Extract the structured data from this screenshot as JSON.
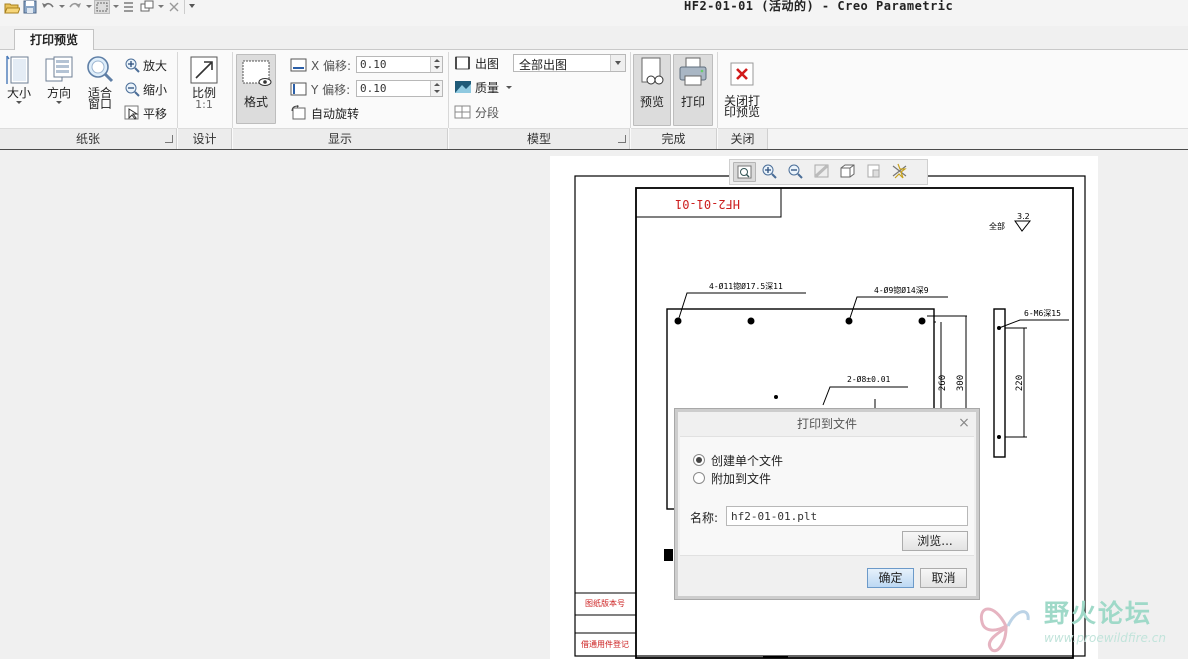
{
  "window": {
    "title": "HF2-01-01 (活动的) - Creo Parametric"
  },
  "tabs": [
    {
      "label": "打印预览",
      "active": true
    }
  ],
  "ribbon": {
    "groups": [
      {
        "label": "纸张"
      },
      {
        "label": "设计"
      },
      {
        "label": "显示"
      },
      {
        "label": "模型"
      },
      {
        "label": "完成"
      },
      {
        "label": "关闭"
      }
    ],
    "paper": {
      "size_label": "大小",
      "orientation_label": "方向",
      "fit_label_1": "适合",
      "fit_label_2": "窗口",
      "zoom_in_label": "放大",
      "zoom_out_label": "缩小",
      "pan_label": "平移"
    },
    "design": {
      "scale_label": "比例",
      "scale_value": "1:1",
      "format_label": "格式"
    },
    "display": {
      "x_offset_label": "X 偏移:",
      "x_offset_value": "0.10",
      "y_offset_label": "Y 偏移:",
      "y_offset_value": "0.10",
      "auto_rotate_label": "自动旋转"
    },
    "model": {
      "drawing_label": "出图",
      "drawing_value": "全部出图",
      "quality_label": "质量",
      "segment_label": "分段"
    },
    "finish": {
      "preview_label": "预览",
      "print_label": "打印"
    },
    "close": {
      "close_label_1": "关闭打",
      "close_label_2": "印预览"
    }
  },
  "drawing": {
    "title_stamp": "HF2-01-01",
    "roughness_prefix": "全部",
    "roughness_value": "3.2",
    "notes": [
      "4-Ø11锪Ø17.5深11",
      "4-Ø9锪Ø14深9",
      "6-M6深15",
      "2-Ø8±0.01"
    ],
    "dims": [
      "260",
      "300",
      "220"
    ],
    "sidebar_labels": [
      "图纸版本号",
      "借通用件登记"
    ]
  },
  "dialog": {
    "title": "打印到文件",
    "close_glyph": "×",
    "option_single": "创建单个文件",
    "option_append": "附加到文件",
    "selected_option": "single",
    "name_label": "名称:",
    "name_value": "hf2-01-01.plt",
    "browse_label": "浏览...",
    "ok_label": "确定",
    "cancel_label": "取消"
  },
  "watermark": {
    "name": "野火论坛",
    "url": "www.proewildfire.cn"
  },
  "colors": {
    "accent_red": "#cc1f1f",
    "dialog_ok": "#bcd8f3",
    "watermark": "#9fd9c8"
  }
}
